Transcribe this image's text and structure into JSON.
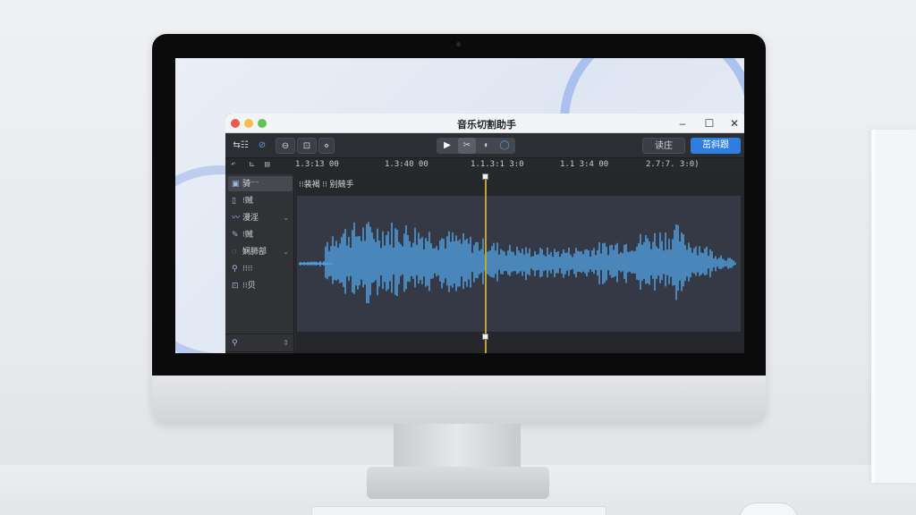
{
  "window": {
    "title": "音乐切割助手",
    "controls": {
      "minimize": "–",
      "maximize": "☐",
      "close": "✕"
    }
  },
  "toolbar": {
    "left_icons": [
      "list-icon",
      "pen-icon",
      "loop-icon",
      "export-icon",
      "more-icon"
    ],
    "transport_icons": [
      "play-icon",
      "cut-icon",
      "record-icon",
      "circle-icon"
    ],
    "preview_label": "读庄",
    "export_label": "茁斜跟"
  },
  "subbar": {
    "icons": [
      "undo-icon",
      "trim-icon",
      "clip-icon"
    ]
  },
  "ruler": {
    "labels": [
      "1.3:13 00",
      "1.3:40 00",
      "1.1.3:1 3:0",
      "1.1 3:4 00",
      "2.7:7. 3:0)"
    ]
  },
  "sidebar": {
    "items": [
      {
        "icon": "layer-icon",
        "label": "骑⁻⁻",
        "active": true,
        "dropdown": false
      },
      {
        "icon": "doc-icon",
        "label": "⁝贼",
        "active": false,
        "dropdown": false
      },
      {
        "icon": "curve-icon",
        "label": "漫淫",
        "active": false,
        "dropdown": true
      },
      {
        "icon": "pen-icon",
        "label": "⁝贼",
        "active": false,
        "dropdown": false
      },
      {
        "icon": "shape-icon",
        "label": "娴肺部",
        "active": false,
        "dropdown": true
      },
      {
        "icon": "key-icon",
        "label": "⁝⁝⁝⁝",
        "active": false,
        "dropdown": false
      },
      {
        "icon": "image-icon",
        "label": "⁝⁝贝",
        "active": false,
        "dropdown": false
      }
    ],
    "bottom_items": [
      {
        "icon": "search-icon",
        "label": "",
        "dropdown": true
      },
      {
        "icon": "settings-icon",
        "label": "挂"
      }
    ]
  },
  "editor": {
    "region_label": "⁝⁝装褐 ⁝⁝ 别兢手",
    "playhead_position": 0.42,
    "scroll_position": 0.45
  },
  "colors": {
    "waveform": "#4f9ad8",
    "playhead": "#c9a227",
    "accent": "#2f7fe0"
  }
}
